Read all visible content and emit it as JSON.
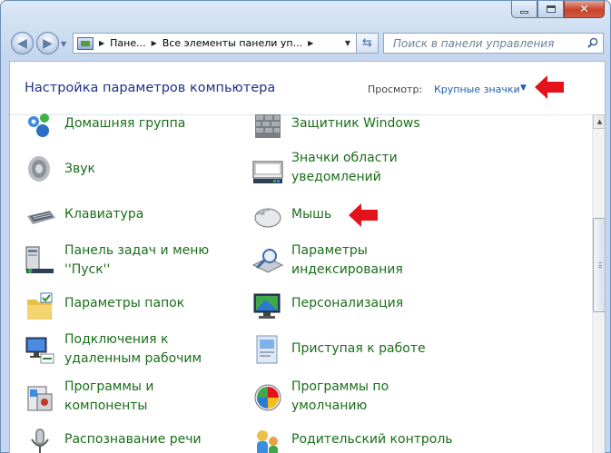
{
  "window": {
    "caption": {
      "minimize": "minimize-icon",
      "maximize": "maximize-icon",
      "close": "close-icon"
    }
  },
  "toolbar": {
    "address_parts": [
      "Пане...",
      "Все элементы панели уп..."
    ],
    "search_placeholder": "Поиск в панели управления"
  },
  "header": {
    "title": "Настройка параметров компьютера",
    "view_label": "Просмотр:",
    "view_value": "Крупные значки"
  },
  "items": [
    {
      "label": "Домашняя группа",
      "icon": "homegroup-icon"
    },
    {
      "label": "Защитник Windows",
      "icon": "windows-defender-icon"
    },
    {
      "label": "Звук",
      "icon": "sound-icon"
    },
    {
      "label": "Значки области\nуведомлений",
      "icon": "notification-icons-icon"
    },
    {
      "label": "Клавиатура",
      "icon": "keyboard-icon"
    },
    {
      "label": "Мышь",
      "icon": "mouse-icon"
    },
    {
      "label": "Панель задач и меню\n''Пуск''",
      "icon": "taskbar-icon"
    },
    {
      "label": "Параметры\nиндексирования",
      "icon": "indexing-icon"
    },
    {
      "label": "Параметры папок",
      "icon": "folder-options-icon"
    },
    {
      "label": "Персонализация",
      "icon": "personalization-icon"
    },
    {
      "label": "Подключения к\nудаленным рабочим",
      "icon": "remote-desktop-icon"
    },
    {
      "label": "Приступая к работе",
      "icon": "getting-started-icon"
    },
    {
      "label": "Программы и\nкомпоненты",
      "icon": "programs-features-icon"
    },
    {
      "label": "Программы по\nумолчанию",
      "icon": "default-programs-icon"
    },
    {
      "label": "Распознавание речи",
      "icon": "speech-recognition-icon"
    },
    {
      "label": "Родительский контроль",
      "icon": "parental-controls-icon"
    }
  ],
  "colors": {
    "link_green": "#1a6e1a",
    "title_blue": "#1e3287",
    "arrow_red": "#e3121b"
  }
}
